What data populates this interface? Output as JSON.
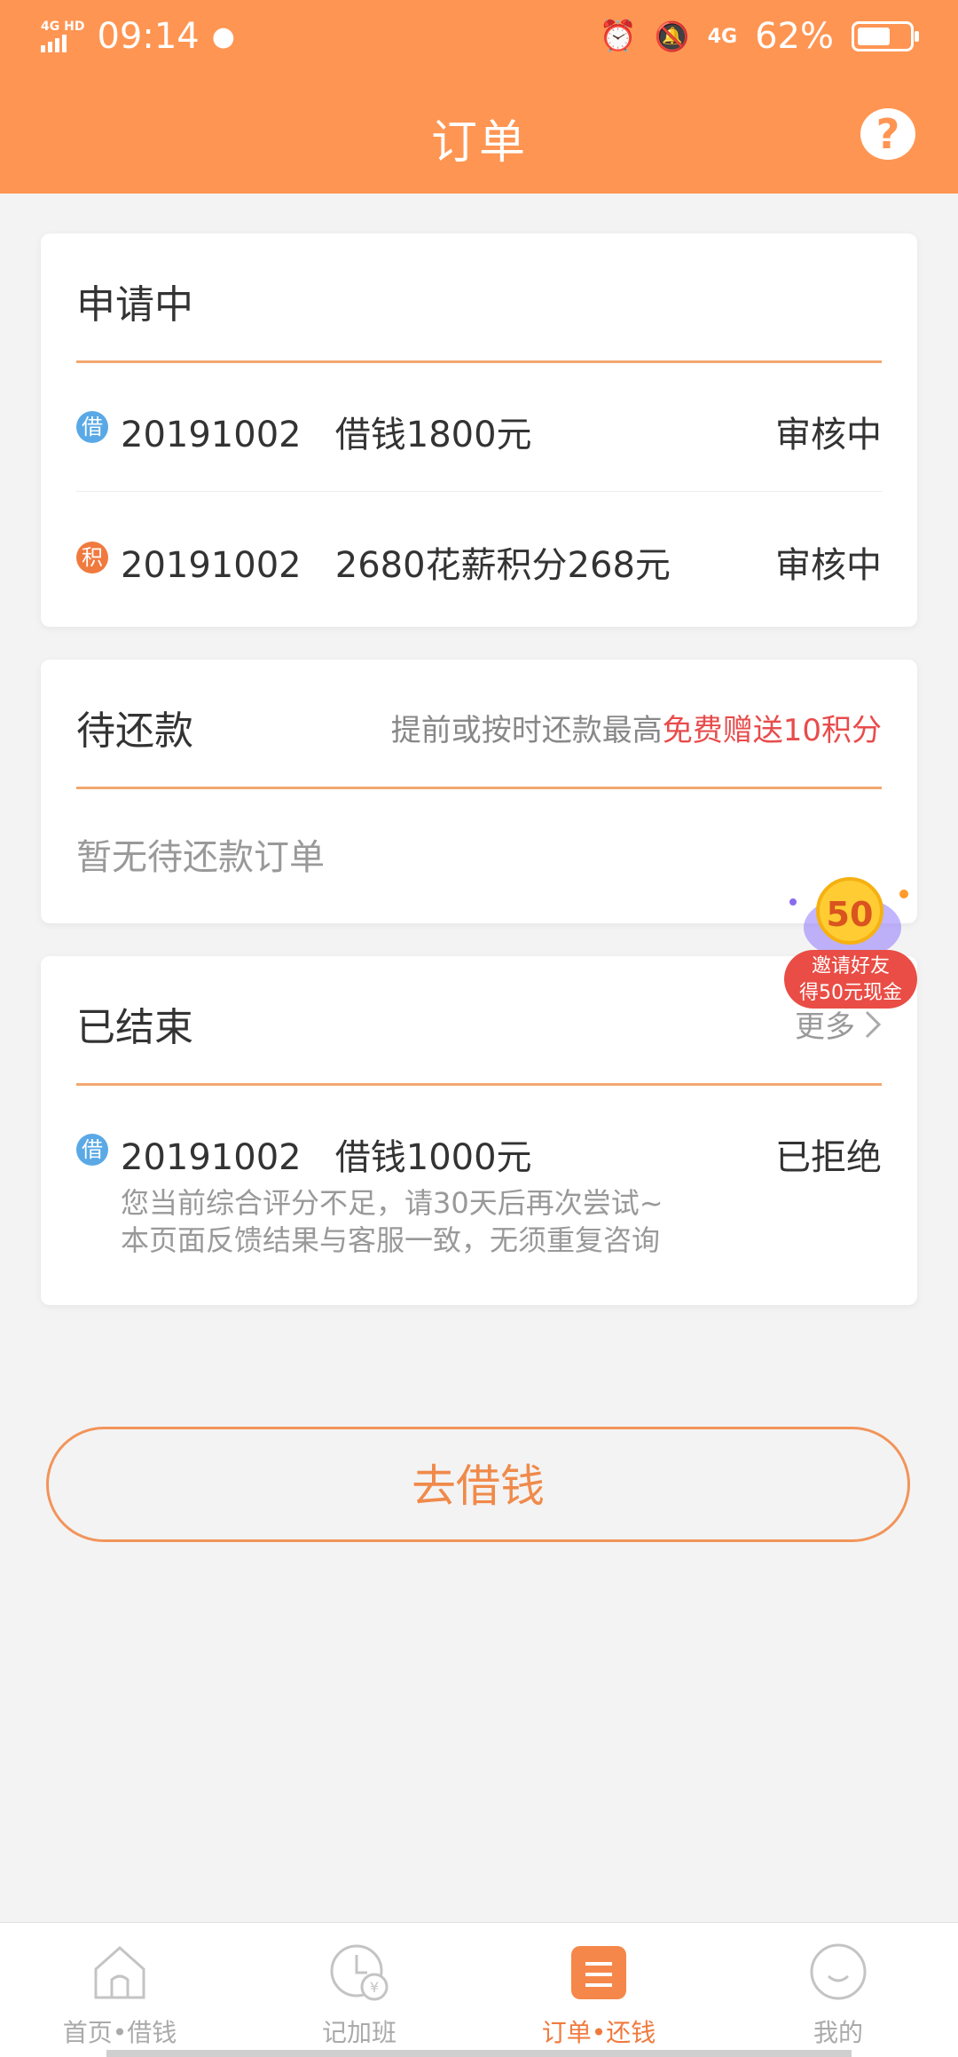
{
  "status_bar": {
    "network": "4G HD",
    "time": "09:14",
    "mobile_data": "4G",
    "battery": "62%"
  },
  "header": {
    "title": "订单",
    "help_label": "?"
  },
  "applying": {
    "title": "申请中",
    "items": [
      {
        "badge": "借",
        "code": "20191002",
        "desc": "借钱1800元",
        "status": "审核中",
        "badge_color": "#5aa9e6"
      },
      {
        "badge": "积",
        "code": "20191002",
        "desc": "2680花薪积分268元",
        "status": "审核中",
        "badge_color": "#f07a3e"
      }
    ]
  },
  "pending": {
    "title": "待还款",
    "tip_prefix": "提前或按时还款最高",
    "tip_highlight": "免费赠送10积分",
    "empty_text": "暂无待还款订单"
  },
  "promo": {
    "coin": "50",
    "label_line1": "邀请好友",
    "label_line2": "得50元现金"
  },
  "finished": {
    "title": "已结束",
    "more_label": "更多",
    "item": {
      "badge": "借",
      "code": "20191002",
      "desc": "借钱1000元",
      "status": "已拒绝",
      "note_line1": "您当前综合评分不足，请30天后再次尝试~",
      "note_line2": "本页面反馈结果与客服一致，无须重复咨询"
    }
  },
  "cta": {
    "label": "去借钱"
  },
  "nav": {
    "items": [
      {
        "label": "首页•借钱",
        "icon": "home-icon"
      },
      {
        "label": "记加班",
        "icon": "clock-yen-icon"
      },
      {
        "label": "订单•还钱",
        "icon": "orders-icon"
      },
      {
        "label": "我的",
        "icon": "smile-icon"
      }
    ]
  },
  "colors": {
    "header_bg": "#ff9552",
    "accent": "#f07a3e",
    "highlight_red": "#e84c4c"
  }
}
